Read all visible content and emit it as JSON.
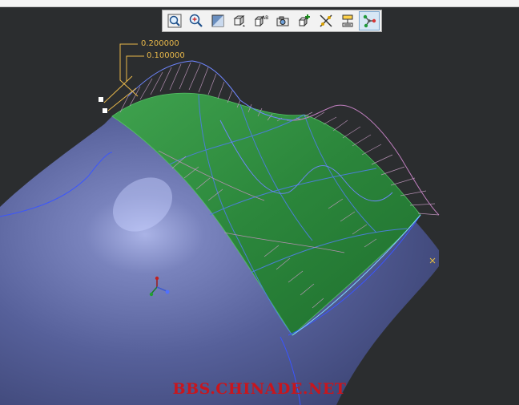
{
  "toolbar": {
    "buttons": [
      {
        "id": "fit-all",
        "icon": "fit-all-icon"
      },
      {
        "id": "zoom-in",
        "icon": "zoom-in-icon"
      },
      {
        "id": "shading",
        "icon": "shading-icon"
      },
      {
        "id": "view-cube",
        "icon": "view-cube-icon"
      },
      {
        "id": "text-view",
        "icon": "text-view-icon"
      },
      {
        "id": "capture",
        "icon": "camera-icon"
      },
      {
        "id": "insert",
        "icon": "insert-icon"
      },
      {
        "id": "mirror",
        "icon": "mirror-icon"
      },
      {
        "id": "analysis",
        "icon": "analysis-icon"
      },
      {
        "id": "node-connect",
        "icon": "node-connect-icon",
        "active": true
      }
    ]
  },
  "dimensions": {
    "upper": "0.200000",
    "lower": "0.100000"
  },
  "watermark": "BBS.CHINADE.NET",
  "colors": {
    "background": "#2b2d2f",
    "body_surface": "#5b6494",
    "green_patch": "#2e8a3e",
    "dimension": "#e8b84a",
    "comb_pink": "#b48fb0",
    "curve_blue": "#6f86ff",
    "watermark": "#c8161d"
  }
}
